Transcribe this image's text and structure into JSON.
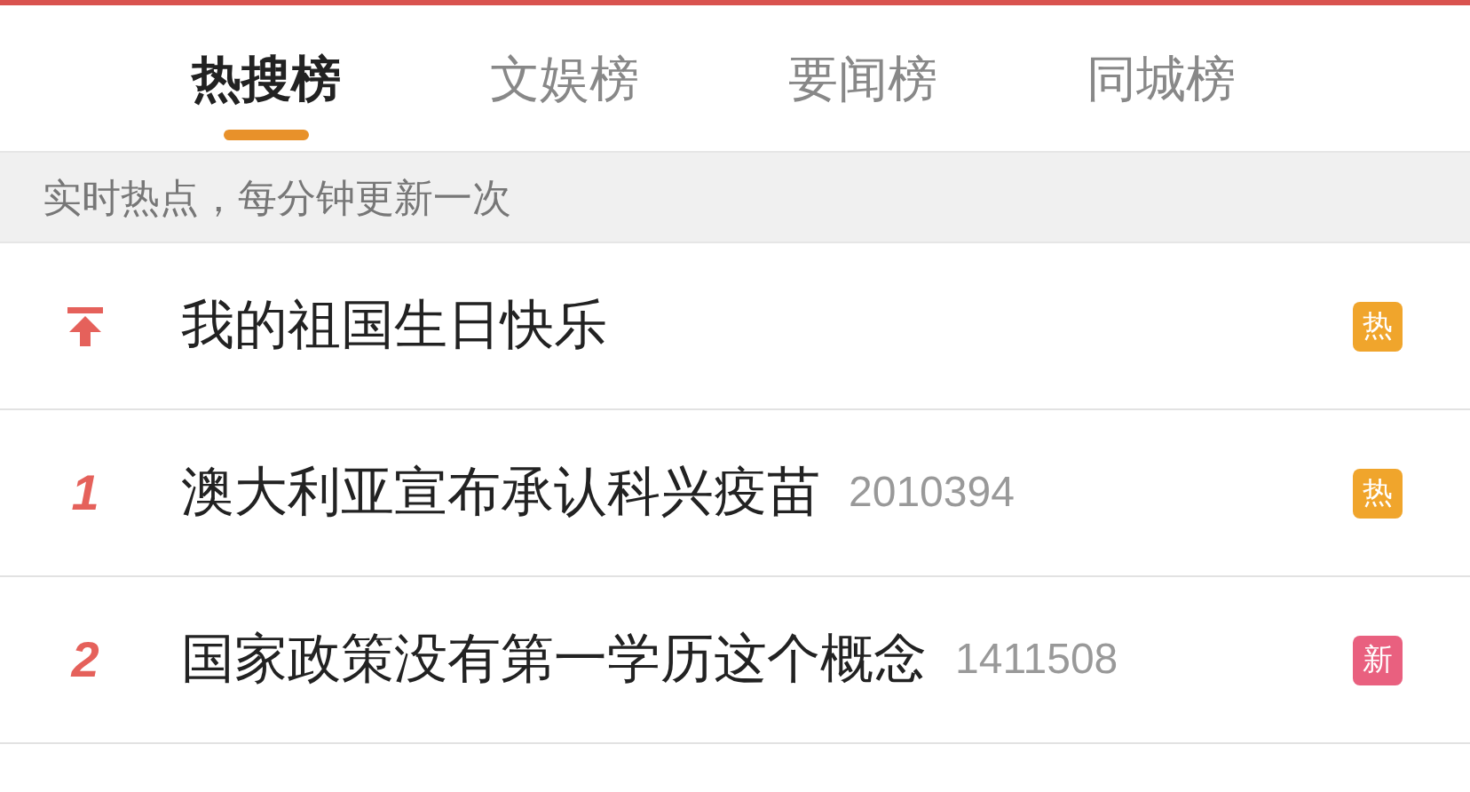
{
  "tabs": [
    {
      "label": "热搜榜",
      "selected": true
    },
    {
      "label": "文娱榜",
      "selected": false
    },
    {
      "label": "要闻榜",
      "selected": false
    },
    {
      "label": "同城榜",
      "selected": false
    }
  ],
  "notice": "实时热点，每分钟更新一次",
  "items": [
    {
      "kind": "pinned",
      "title": "我的祖国生日快乐",
      "badge": {
        "label": "热",
        "color": "#f0a52c"
      }
    },
    {
      "kind": "ranked",
      "rank": "1",
      "title": "澳大利亚宣布承认科兴疫苗",
      "count": "2010394",
      "badge": {
        "label": "热",
        "color": "#f0a52c"
      }
    },
    {
      "kind": "ranked",
      "rank": "2",
      "title": "国家政策没有第一学历这个概念",
      "count": "1411508",
      "badge": {
        "label": "新",
        "color": "#e9607f"
      }
    }
  ]
}
